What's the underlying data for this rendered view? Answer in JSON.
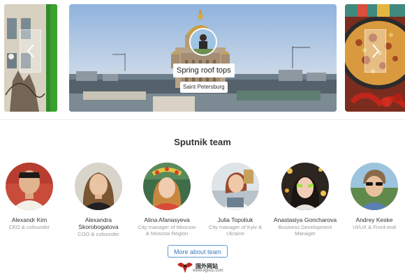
{
  "carousel": {
    "featured": {
      "title": "Spring roof tops",
      "city": "Saint Petersburg"
    },
    "prev_icon": "chevron-left-icon",
    "next_icon": "chevron-right-icon"
  },
  "team": {
    "heading": "Sputnik team",
    "members": [
      {
        "name_line1": "Alexandr Kim",
        "name_line2": "",
        "role_line1": "CEO & cofounder",
        "role_line2": ""
      },
      {
        "name_line1": "Alexandra",
        "name_line2": "Skorobogatova",
        "role_line1": "COO & cofounder",
        "role_line2": ""
      },
      {
        "name_line1": "Alina Afanasyeva",
        "name_line2": "",
        "role_line1": "City manager of Moscow",
        "role_line2": "& Moscow Region"
      },
      {
        "name_line1": "Julia Topoliuk",
        "name_line2": "",
        "role_line1": "City manager of Kyiv &",
        "role_line2": "Ukraine"
      },
      {
        "name_line1": "Anastasiya Goncharova",
        "name_line2": "",
        "role_line1": "Business Development",
        "role_line2": "Manager"
      },
      {
        "name_line1": "Andrey Keske",
        "name_line2": "",
        "role_line1": "UI/UX & Front-end",
        "role_line2": ""
      }
    ],
    "more_button": "More about team"
  },
  "watermark": {
    "title": "国外网站",
    "url": "www.egouz.com"
  },
  "colors": {
    "accent": "#3a7bbf",
    "button_border": "#5b9bd5",
    "heading": "#333333",
    "muted": "#999999"
  }
}
